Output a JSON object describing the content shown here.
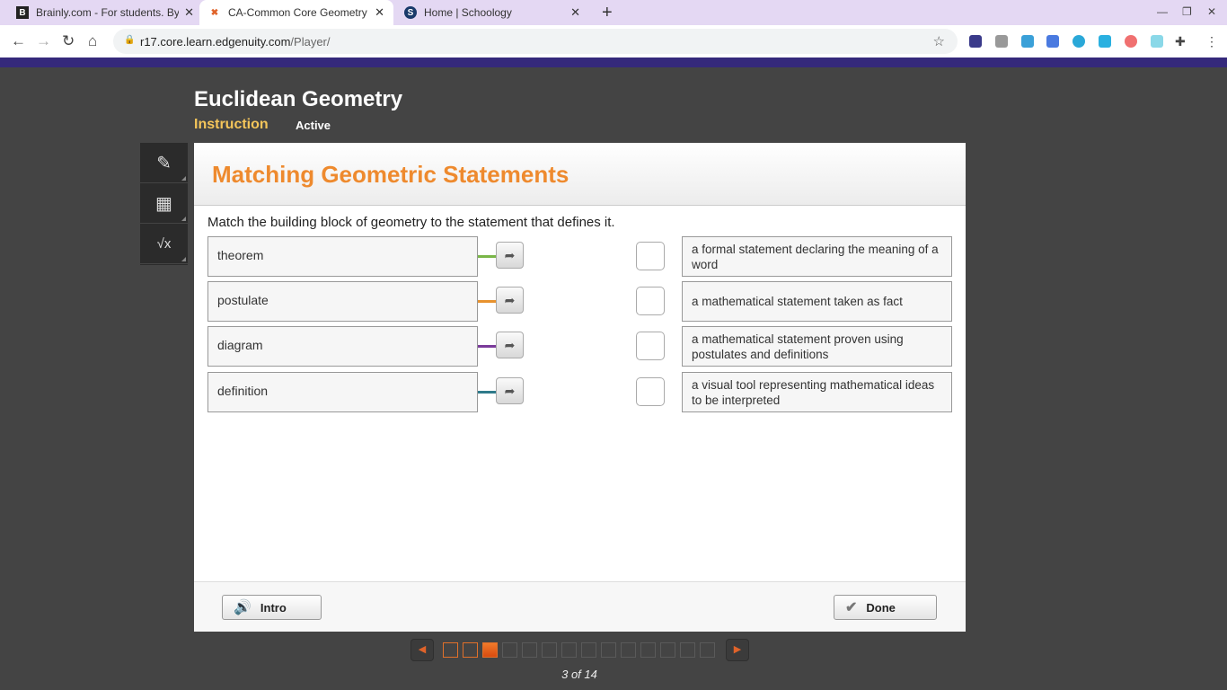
{
  "browser": {
    "tabs": [
      {
        "title": "Brainly.com - For students. By st",
        "icon": "brainly-icon"
      },
      {
        "title": "CA-Common Core Geometry A-C",
        "icon": "edgenuity-icon",
        "active": true
      },
      {
        "title": "Home | Schoology",
        "icon": "schoology-icon"
      }
    ],
    "url_host": "r17.core.learn.edgenuity.com",
    "url_path": "/Player/"
  },
  "course": {
    "title": "Euclidean Geometry",
    "section": "Instruction",
    "status": "Active"
  },
  "tools": [
    "pencil-icon",
    "calculator-icon",
    "formula-icon"
  ],
  "activity": {
    "title": "Matching Geometric Statements",
    "prompt": "Match the building block of geometry to the statement that defines it.",
    "terms": [
      {
        "label": "theorem",
        "color": "#7ab648"
      },
      {
        "label": "postulate",
        "color": "#e8922e"
      },
      {
        "label": "diagram",
        "color": "#7a3a9a"
      },
      {
        "label": "definition",
        "color": "#2f7a8a"
      }
    ],
    "definitions": [
      "a formal statement declaring the meaning of a word",
      "a mathematical statement taken as fact",
      "a mathematical statement proven using postulates and definitions",
      "a visual tool representing mathematical ideas to be interpreted"
    ]
  },
  "footer": {
    "intro": "Intro",
    "done": "Done"
  },
  "pagination": {
    "current": 3,
    "total": 14,
    "label": "3 of 14"
  }
}
